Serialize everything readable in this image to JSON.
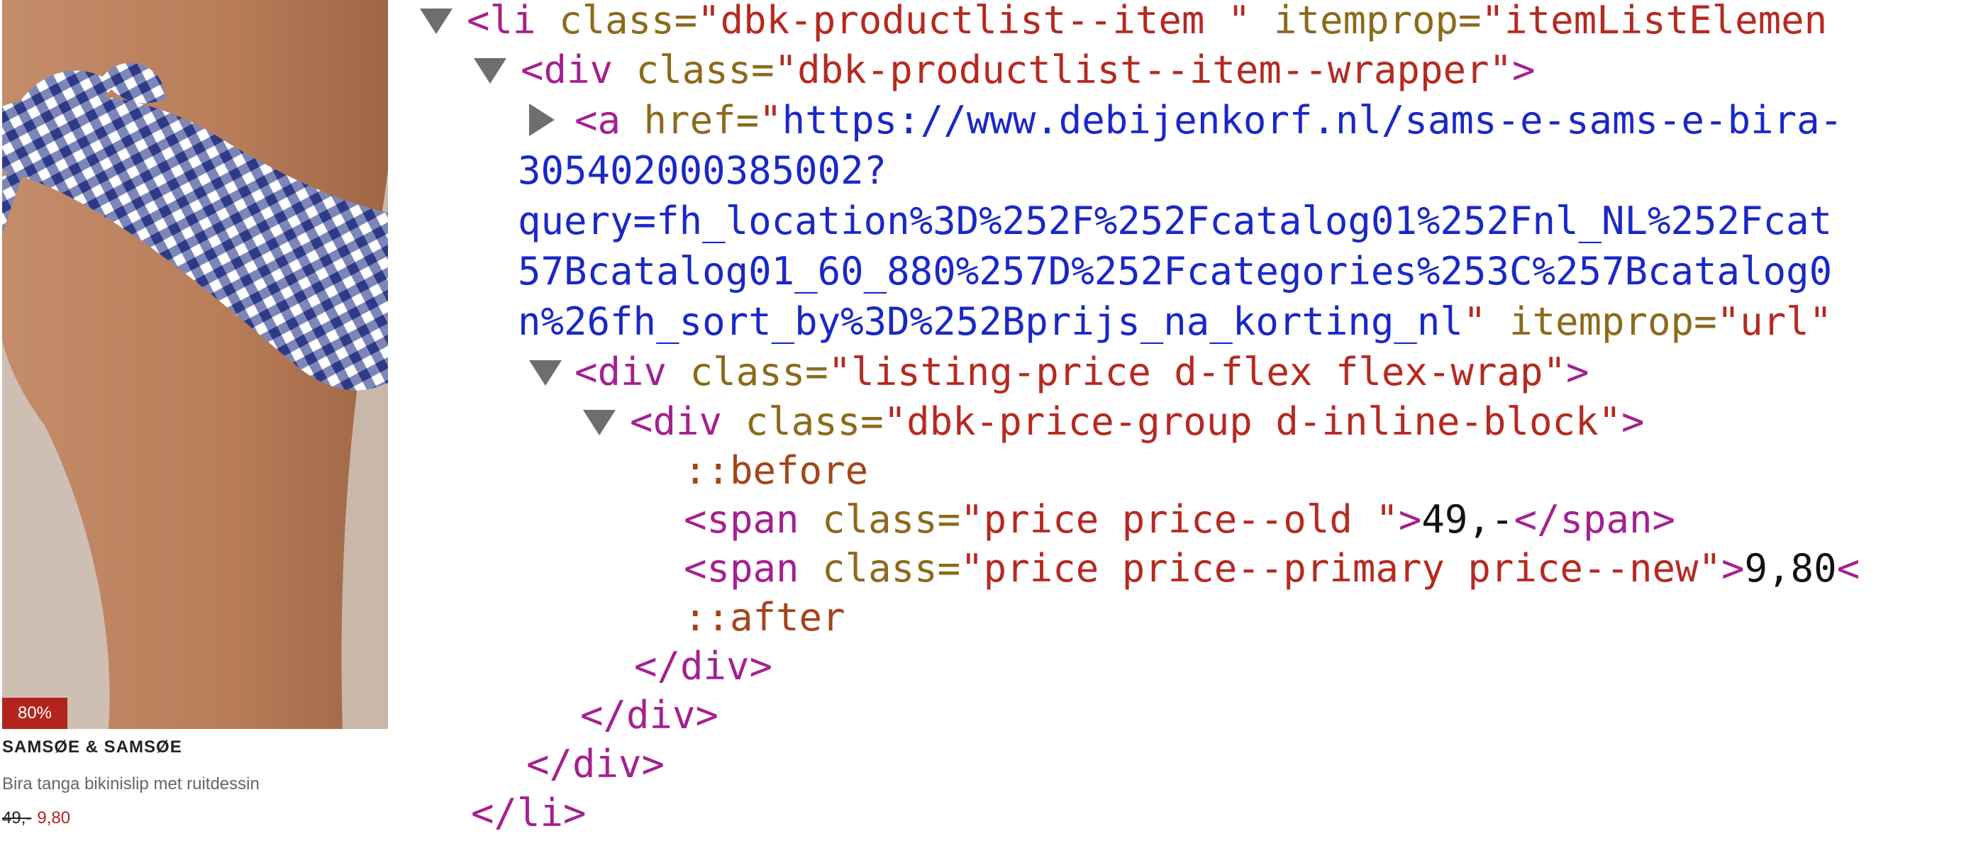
{
  "product": {
    "discount_badge": "80%",
    "brand": "SAMSØE & SAMSØE",
    "title": "Bira tanga bikinislip met ruitdessin",
    "price_old": "49,-",
    "price_new": "9,80",
    "image_subject": "bikini bottom with blue gingham pattern",
    "colors": {
      "badge": "#b3241e",
      "price_new": "#b3241e"
    }
  },
  "devtools": {
    "li_open": {
      "tag": "<li",
      "attr1": "class=",
      "val1": "\"dbk-productlist--item \"",
      "attr2": "itemprop=",
      "val2": "\"itemListElemen"
    },
    "wrapper_div": {
      "tag": "<div",
      "attr": "class=",
      "val": "\"dbk-productlist--item--wrapper\"",
      "close": ">"
    },
    "anchor": {
      "tag": "<a",
      "attr": "href=",
      "quote": "\"",
      "url_line1": "https://www.debijenkorf.nl/sams-e-sams-e-bira-",
      "url_line2": "305402000385002?",
      "url_line3": "query=fh_location%3D%252F%252Fcatalog01%252Fnl_NL%252Fcat",
      "url_line4": "57Bcatalog01_60_880%257D%252Fcategories%253C%257Bcatalog0",
      "url_line5": "n%26fh_sort_by%3D%252Bprijs_na_korting_nl",
      "end_quote": "\"",
      "attr2": "itemprop=",
      "val2": "\"url\""
    },
    "listing_price_div": {
      "tag": "<div",
      "attr": "class=",
      "val": "\"listing-price d-flex flex-wrap\"",
      "close": ">"
    },
    "price_group_div": {
      "tag": "<div",
      "attr": "class=",
      "val": "\"dbk-price-group d-inline-block\"",
      "close": ">"
    },
    "pseudo_before": "::before",
    "span_old": {
      "tag": "<span",
      "attr": "class=",
      "val": "\"price price--old \"",
      "close": ">",
      "text": "49,-",
      "end": "</span>"
    },
    "span_new": {
      "tag": "<span",
      "attr": "class=",
      "val": "\"price price--primary price--new\"",
      "close": ">",
      "text": "9,80",
      "end": "<"
    },
    "pseudo_after": "::after",
    "close_div_1": "</div>",
    "close_div_2": "</div>",
    "close_div_3": "</div>",
    "close_li": "</li>"
  }
}
